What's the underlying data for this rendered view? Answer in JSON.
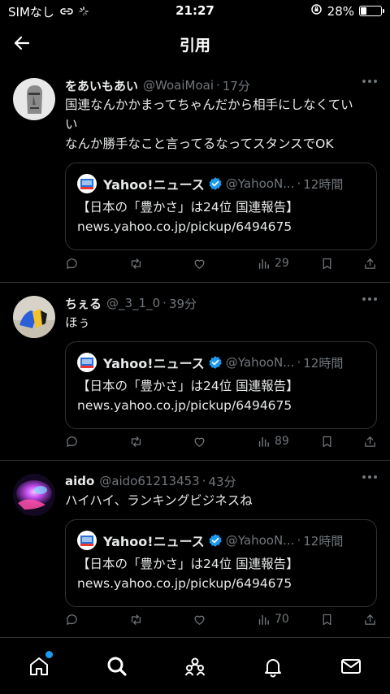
{
  "status": {
    "carrier": "SIMなし",
    "time": "21:27",
    "battery": "28%",
    "battery_level": 0.28
  },
  "header": {
    "title": "引用"
  },
  "quoted": {
    "name": "Yahoo!ニュース",
    "handle": "@YahooN...",
    "time": "12時間",
    "text_line1": "【日本の「豊かさ」は24位 国連報告】",
    "text_line2": "news.yahoo.co.jp/pickup/6494675"
  },
  "posts": [
    {
      "author": "をあいもあい",
      "handle": "@WoaiMoai",
      "time": "17分",
      "text": "国連なんかかまってちゃんだから相手にしなくてい\nい\nなんか勝手なこと言ってるなってスタンスでOK",
      "views": "29"
    },
    {
      "author": "ちぇる",
      "handle": "@_3_1_0",
      "time": "39分",
      "text": "ほぅ",
      "views": "89"
    },
    {
      "author": "aido",
      "handle": "@aido61213453",
      "time": "43分",
      "text": "ハイハイ、ランキングビジネスね",
      "views": "70"
    }
  ],
  "colors": {
    "background": "#000000",
    "text": "#e7e9ea",
    "muted": "#71767b",
    "border": "#2f3336",
    "accent": "#1d9bf0"
  },
  "icons": [
    "back-arrow-icon",
    "more-icon",
    "reply-icon",
    "repost-icon",
    "like-icon",
    "views-icon",
    "bookmark-icon",
    "share-icon",
    "home-icon",
    "search-icon",
    "communities-icon",
    "notifications-icon",
    "messages-icon",
    "verified-icon"
  ]
}
